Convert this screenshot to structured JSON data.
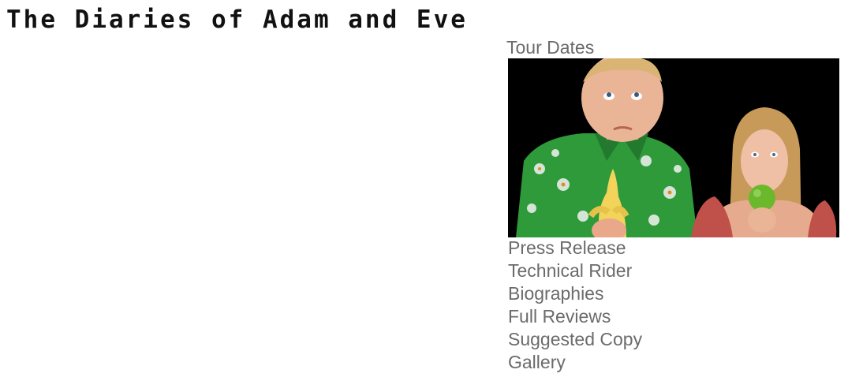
{
  "site": {
    "title": "The Diaries of Adam and Eve"
  },
  "nav": {
    "tour_dates": "Tour Dates",
    "items": [
      {
        "label": "Press Release"
      },
      {
        "label": "Technical Rider"
      },
      {
        "label": "Biographies"
      },
      {
        "label": "Full Reviews"
      },
      {
        "label": "Suggested Copy"
      },
      {
        "label": "Gallery"
      }
    ]
  },
  "colors": {
    "link": "#6b6b6b",
    "title": "#111111",
    "photo_background": "#000000"
  }
}
